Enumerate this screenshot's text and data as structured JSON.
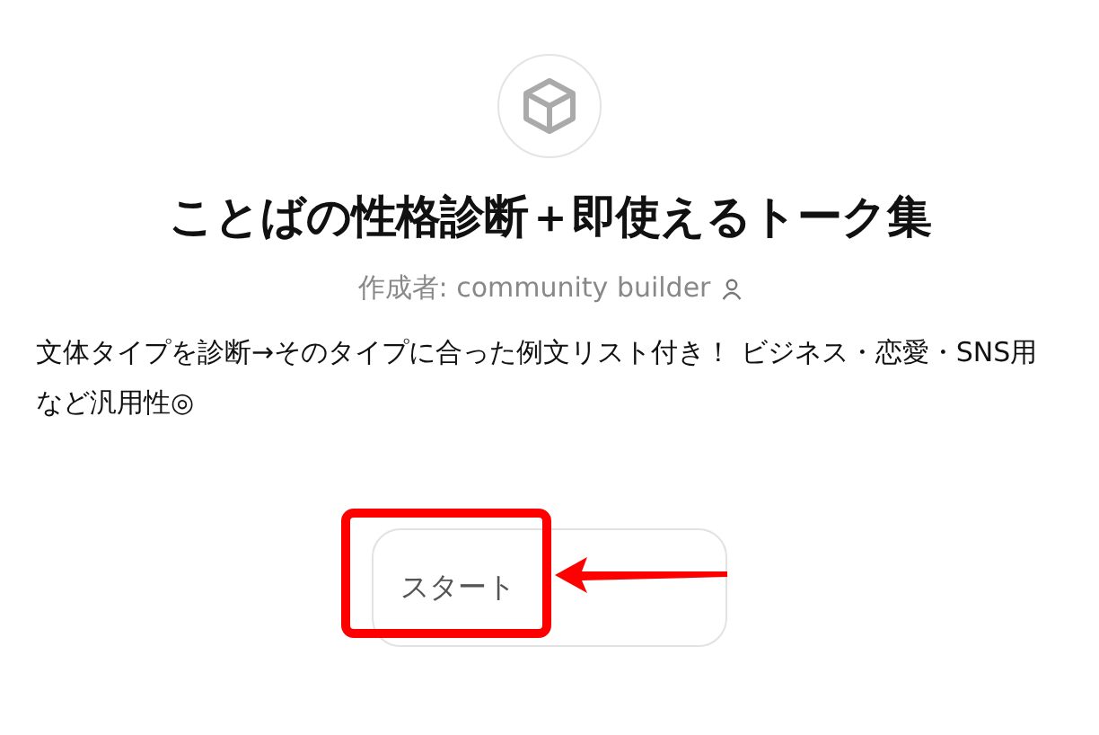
{
  "title": "ことばの性格診断＋即使えるトーク集",
  "author": "作成者: community builder",
  "description": "文体タイプを診断→そのタイプに合った例文リスト付き！ ビジネス・恋愛・SNS用など汎用性◎",
  "start_button": "スタート"
}
